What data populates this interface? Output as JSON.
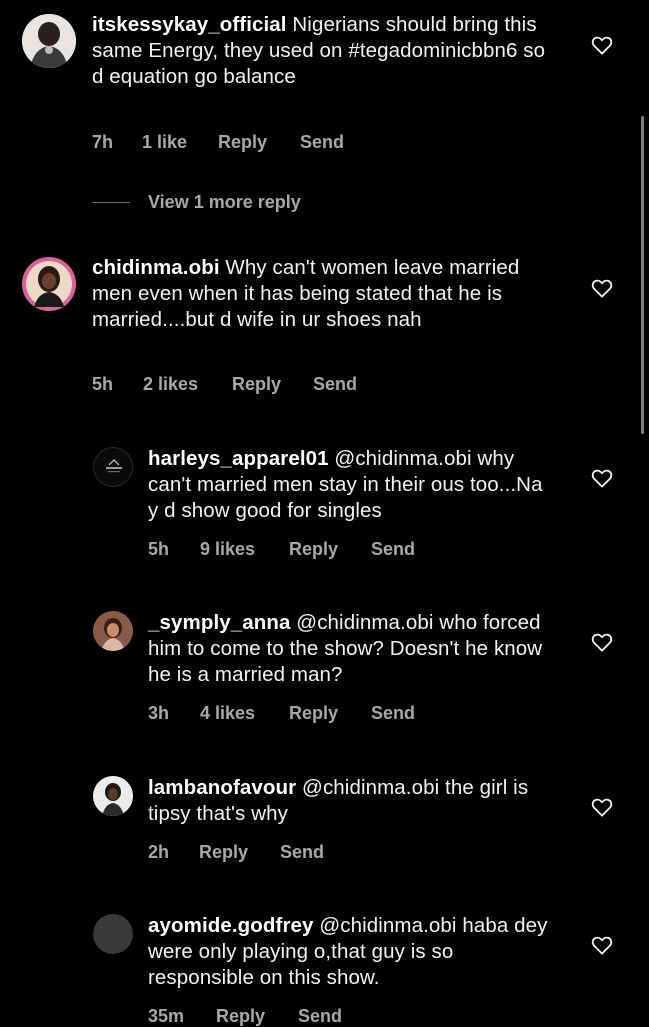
{
  "comments": [
    {
      "username": "itskessykay_official",
      "text": "Nigerians should bring this same Energy, they used on #tegadominicbbn6 so d equation go balance",
      "time": "7h",
      "likes": "1 like",
      "reply": "Reply",
      "send": "Send"
    },
    {
      "username": "chidinma.obi",
      "text": "Why can't women leave married men even when it has being stated that he is married....but d wife in ur shoes nah",
      "time": "5h",
      "likes": "2 likes",
      "reply": "Reply",
      "send": "Send"
    },
    {
      "username": "harleys_apparel01",
      "text": "@chidinma.obi why can't married men stay in their ous too...Na y d show good for singles",
      "time": "5h",
      "likes": "9 likes",
      "reply": "Reply",
      "send": "Send"
    },
    {
      "username": "_symply_anna",
      "text": "@chidinma.obi who forced him to come to the show? Doesn't he know he is a married man?",
      "time": "3h",
      "likes": "4 likes",
      "reply": "Reply",
      "send": "Send"
    },
    {
      "username": "lambanofavour",
      "text": "@chidinma.obi the girl is tipsy that's why",
      "time": "2h",
      "likes": "",
      "reply": "Reply",
      "send": "Send"
    },
    {
      "username": "ayomide.godfrey",
      "text": "@chidinma.obi haba dey were only playing o,that guy is so responsible on this show.",
      "time": "35m",
      "likes": "",
      "reply": "Reply",
      "send": "Send"
    }
  ],
  "view_more": "View 1 more reply",
  "icons": {
    "like": "heart-outline-icon"
  },
  "colors": {
    "background": "#000000",
    "text": "#f2f2f2",
    "meta": "#a8a8a8"
  }
}
